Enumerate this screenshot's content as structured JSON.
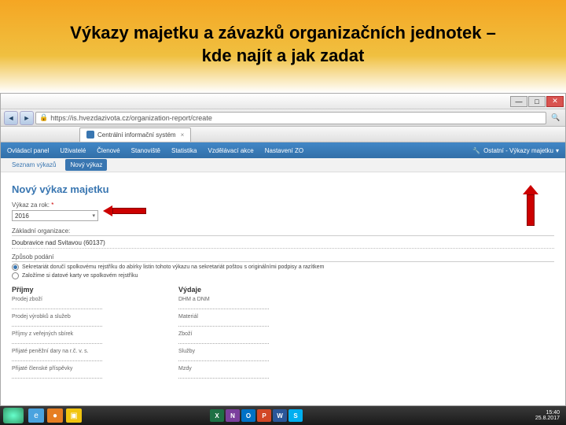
{
  "slide": {
    "title_l1": "Výkazy majetku a závazků organizačních jednotek –",
    "title_l2": "kde najít a jak zadat"
  },
  "browser": {
    "url": "https://is.hvezdazivota.cz/organization-report/create",
    "tab_title": "Centrální informační systém",
    "win": {
      "min": "—",
      "max": "□",
      "close": "✕"
    }
  },
  "menu": {
    "items": [
      "Ovládací panel",
      "Uživatelé",
      "Členové",
      "Stanoviště",
      "Statistika",
      "Vzdělávací akce",
      "Nastavení ZO"
    ],
    "right_label": "Ostatní - Výkazy majetku"
  },
  "subtabs": {
    "list": "Seznam výkazů",
    "new": "Nový výkaz"
  },
  "form": {
    "heading": "Nový výkaz majetku",
    "year_lbl": "Výkaz za rok:",
    "year_val": "2016",
    "org_head": "Základní organizace:",
    "org_val": "Doubravice nad Svitavou (60137)",
    "method_head": "Způsob podání",
    "method_opt1": "Sekretariát doručí spolkovému rejstříku do abírky listin tohoto výkazu na sekretariát poštou s originálními podpisy a razítkem",
    "method_opt2": "Založíme si datové karty ve spolkovém rejstříku",
    "col1": {
      "title": "Příjmy",
      "f1": "Prodej zboží",
      "f2": "Prodej výrobků a služeb",
      "f3": "Příjmy z veřejných sbírek",
      "f4": "Přijaté peněžní dary na r.č. v. s.",
      "f5": "Přijaté členské příspěvky"
    },
    "col2": {
      "title": "Výdaje",
      "f1": "DHM a DNM",
      "f2": "Materiál",
      "f3": "Zboží",
      "f4": "Služby",
      "f5": "Mzdy"
    }
  },
  "taskbar": {
    "time": "15:40",
    "date": "25.8.2017"
  }
}
